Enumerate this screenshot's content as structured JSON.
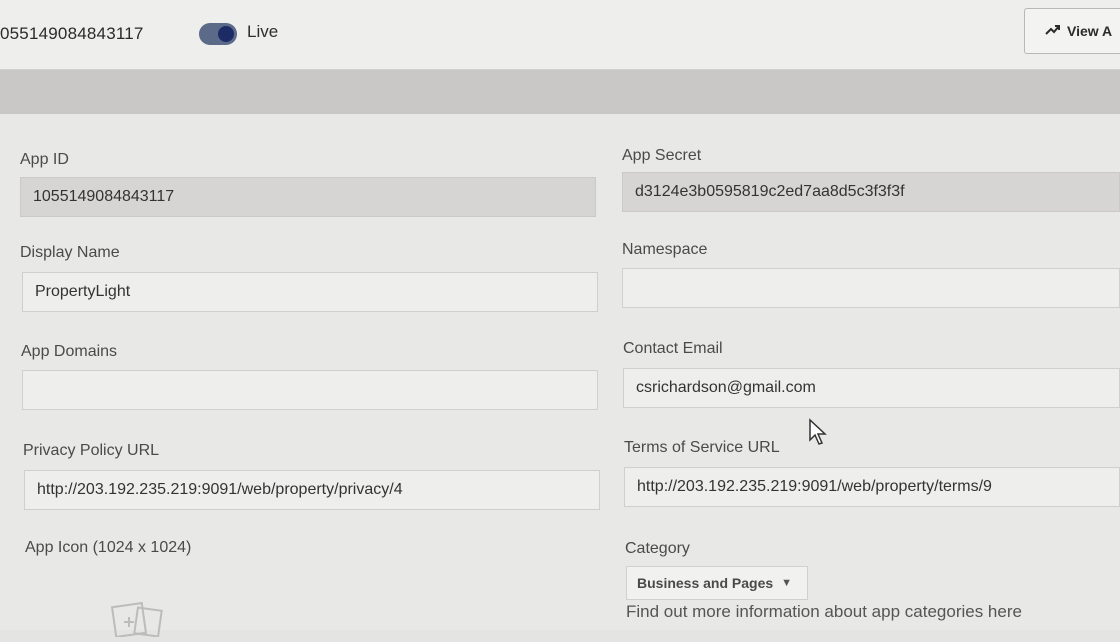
{
  "header": {
    "app_id": "055149084843117",
    "live_label": "Live",
    "view_button_label": "View A",
    "view_button_icon": "trending-up-icon"
  },
  "form": {
    "app_id": {
      "label": "App ID",
      "value": "1055149084843117"
    },
    "app_secret": {
      "label": "App Secret",
      "value": "d3124e3b0595819c2ed7aa8d5c3f3f3f"
    },
    "display_name": {
      "label": "Display Name",
      "value": "PropertyLight"
    },
    "namespace": {
      "label": "Namespace",
      "value": ""
    },
    "app_domains": {
      "label": "App Domains",
      "value": ""
    },
    "contact_email": {
      "label": "Contact Email",
      "value": "csrichardson@gmail.com"
    },
    "privacy_policy_url": {
      "label": "Privacy Policy URL",
      "value": "http://203.192.235.219:9091/web/property/privacy/4"
    },
    "terms_of_service_url": {
      "label": "Terms of Service URL",
      "value": "http://203.192.235.219:9091/web/property/terms/9"
    },
    "app_icon": {
      "label": "App Icon (1024 x 1024)"
    },
    "category": {
      "label": "Category",
      "selected": "Business and Pages",
      "help_text": "Find out more information about app categories here"
    }
  },
  "colors": {
    "toggle_on": "#1c2a66",
    "panel_bg": "#e8e8e6",
    "readonly_field_bg": "#d6d5d3"
  }
}
